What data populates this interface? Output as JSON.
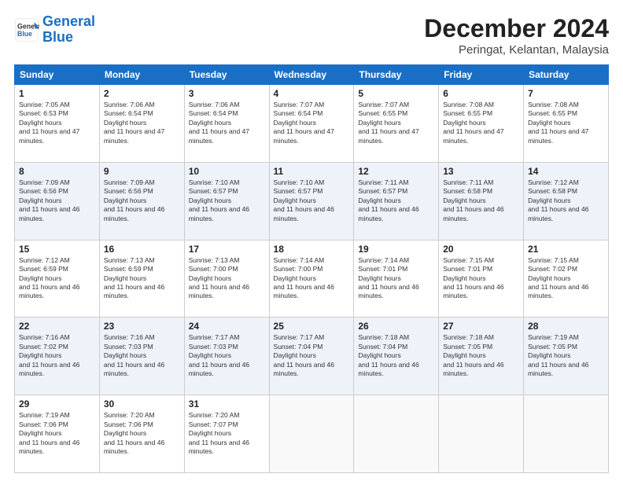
{
  "header": {
    "logo_line1": "General",
    "logo_line2": "Blue",
    "month": "December 2024",
    "location": "Peringat, Kelantan, Malaysia"
  },
  "weekdays": [
    "Sunday",
    "Monday",
    "Tuesday",
    "Wednesday",
    "Thursday",
    "Friday",
    "Saturday"
  ],
  "weeks": [
    [
      {
        "day": 1,
        "sunrise": "7:05 AM",
        "sunset": "6:53 PM",
        "daylight": "11 hours and 47 minutes."
      },
      {
        "day": 2,
        "sunrise": "7:06 AM",
        "sunset": "6:54 PM",
        "daylight": "11 hours and 47 minutes."
      },
      {
        "day": 3,
        "sunrise": "7:06 AM",
        "sunset": "6:54 PM",
        "daylight": "11 hours and 47 minutes."
      },
      {
        "day": 4,
        "sunrise": "7:07 AM",
        "sunset": "6:54 PM",
        "daylight": "11 hours and 47 minutes."
      },
      {
        "day": 5,
        "sunrise": "7:07 AM",
        "sunset": "6:55 PM",
        "daylight": "11 hours and 47 minutes."
      },
      {
        "day": 6,
        "sunrise": "7:08 AM",
        "sunset": "6:55 PM",
        "daylight": "11 hours and 47 minutes."
      },
      {
        "day": 7,
        "sunrise": "7:08 AM",
        "sunset": "6:55 PM",
        "daylight": "11 hours and 47 minutes."
      }
    ],
    [
      {
        "day": 8,
        "sunrise": "7:09 AM",
        "sunset": "6:56 PM",
        "daylight": "11 hours and 46 minutes."
      },
      {
        "day": 9,
        "sunrise": "7:09 AM",
        "sunset": "6:56 PM",
        "daylight": "11 hours and 46 minutes."
      },
      {
        "day": 10,
        "sunrise": "7:10 AM",
        "sunset": "6:57 PM",
        "daylight": "11 hours and 46 minutes."
      },
      {
        "day": 11,
        "sunrise": "7:10 AM",
        "sunset": "6:57 PM",
        "daylight": "11 hours and 46 minutes."
      },
      {
        "day": 12,
        "sunrise": "7:11 AM",
        "sunset": "6:57 PM",
        "daylight": "11 hours and 46 minutes."
      },
      {
        "day": 13,
        "sunrise": "7:11 AM",
        "sunset": "6:58 PM",
        "daylight": "11 hours and 46 minutes."
      },
      {
        "day": 14,
        "sunrise": "7:12 AM",
        "sunset": "6:58 PM",
        "daylight": "11 hours and 46 minutes."
      }
    ],
    [
      {
        "day": 15,
        "sunrise": "7:12 AM",
        "sunset": "6:59 PM",
        "daylight": "11 hours and 46 minutes."
      },
      {
        "day": 16,
        "sunrise": "7:13 AM",
        "sunset": "6:59 PM",
        "daylight": "11 hours and 46 minutes."
      },
      {
        "day": 17,
        "sunrise": "7:13 AM",
        "sunset": "7:00 PM",
        "daylight": "11 hours and 46 minutes."
      },
      {
        "day": 18,
        "sunrise": "7:14 AM",
        "sunset": "7:00 PM",
        "daylight": "11 hours and 46 minutes."
      },
      {
        "day": 19,
        "sunrise": "7:14 AM",
        "sunset": "7:01 PM",
        "daylight": "11 hours and 46 minutes."
      },
      {
        "day": 20,
        "sunrise": "7:15 AM",
        "sunset": "7:01 PM",
        "daylight": "11 hours and 46 minutes."
      },
      {
        "day": 21,
        "sunrise": "7:15 AM",
        "sunset": "7:02 PM",
        "daylight": "11 hours and 46 minutes."
      }
    ],
    [
      {
        "day": 22,
        "sunrise": "7:16 AM",
        "sunset": "7:02 PM",
        "daylight": "11 hours and 46 minutes."
      },
      {
        "day": 23,
        "sunrise": "7:16 AM",
        "sunset": "7:03 PM",
        "daylight": "11 hours and 46 minutes."
      },
      {
        "day": 24,
        "sunrise": "7:17 AM",
        "sunset": "7:03 PM",
        "daylight": "11 hours and 46 minutes."
      },
      {
        "day": 25,
        "sunrise": "7:17 AM",
        "sunset": "7:04 PM",
        "daylight": "11 hours and 46 minutes."
      },
      {
        "day": 26,
        "sunrise": "7:18 AM",
        "sunset": "7:04 PM",
        "daylight": "11 hours and 46 minutes."
      },
      {
        "day": 27,
        "sunrise": "7:18 AM",
        "sunset": "7:05 PM",
        "daylight": "11 hours and 46 minutes."
      },
      {
        "day": 28,
        "sunrise": "7:19 AM",
        "sunset": "7:05 PM",
        "daylight": "11 hours and 46 minutes."
      }
    ],
    [
      {
        "day": 29,
        "sunrise": "7:19 AM",
        "sunset": "7:06 PM",
        "daylight": "11 hours and 46 minutes."
      },
      {
        "day": 30,
        "sunrise": "7:20 AM",
        "sunset": "7:06 PM",
        "daylight": "11 hours and 46 minutes."
      },
      {
        "day": 31,
        "sunrise": "7:20 AM",
        "sunset": "7:07 PM",
        "daylight": "11 hours and 46 minutes."
      },
      null,
      null,
      null,
      null
    ]
  ]
}
